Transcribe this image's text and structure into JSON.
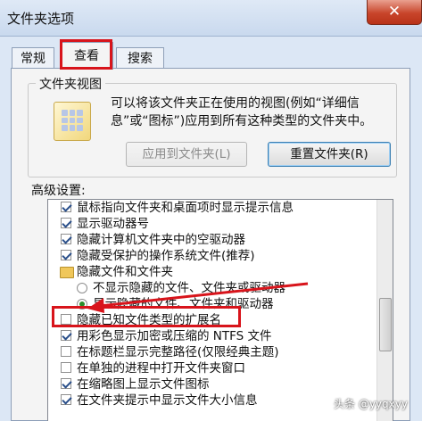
{
  "window": {
    "title": "文件夹选项",
    "close_label": "✕"
  },
  "tabs": [
    {
      "label": "常规"
    },
    {
      "label": "查看"
    },
    {
      "label": "搜索"
    }
  ],
  "folder_view": {
    "legend": "文件夹视图",
    "description": "可以将该文件夹正在使用的视图(例如“详细信息”或“图标”)应用到所有这种类型的文件夹中。",
    "apply_button": "应用到文件夹(L)",
    "reset_button": "重置文件夹(R)"
  },
  "advanced": {
    "label": "高级设置:",
    "items": [
      {
        "type": "checkbox",
        "checked": true,
        "label": "鼠标指向文件夹和桌面项时显示提示信息"
      },
      {
        "type": "checkbox",
        "checked": true,
        "label": "显示驱动器号"
      },
      {
        "type": "checkbox",
        "checked": true,
        "label": "隐藏计算机文件夹中的空驱动器"
      },
      {
        "type": "checkbox",
        "checked": true,
        "label": "隐藏受保护的操作系统文件(推荐)"
      },
      {
        "type": "folder",
        "label": "隐藏文件和文件夹"
      },
      {
        "type": "radio",
        "checked": false,
        "label": "不显示隐藏的文件、文件夹或驱动器"
      },
      {
        "type": "radio",
        "checked": true,
        "label": "显示隐藏的文件、文件夹和驱动器"
      },
      {
        "type": "checkbox",
        "checked": false,
        "label": "隐藏已知文件类型的扩展名"
      },
      {
        "type": "checkbox",
        "checked": true,
        "label": "用彩色显示加密或压缩的 NTFS 文件"
      },
      {
        "type": "checkbox",
        "checked": false,
        "label": "在标题栏显示完整路径(仅限经典主题)"
      },
      {
        "type": "checkbox",
        "checked": false,
        "label": "在单独的进程中打开文件夹窗口"
      },
      {
        "type": "checkbox",
        "checked": true,
        "label": "在缩略图上显示文件图标"
      },
      {
        "type": "checkbox",
        "checked": true,
        "label": "在文件夹提示中显示文件大小信息"
      }
    ]
  },
  "watermark": "头条 @yyqxyy",
  "colors": {
    "highlight_red": "#d8141b"
  }
}
